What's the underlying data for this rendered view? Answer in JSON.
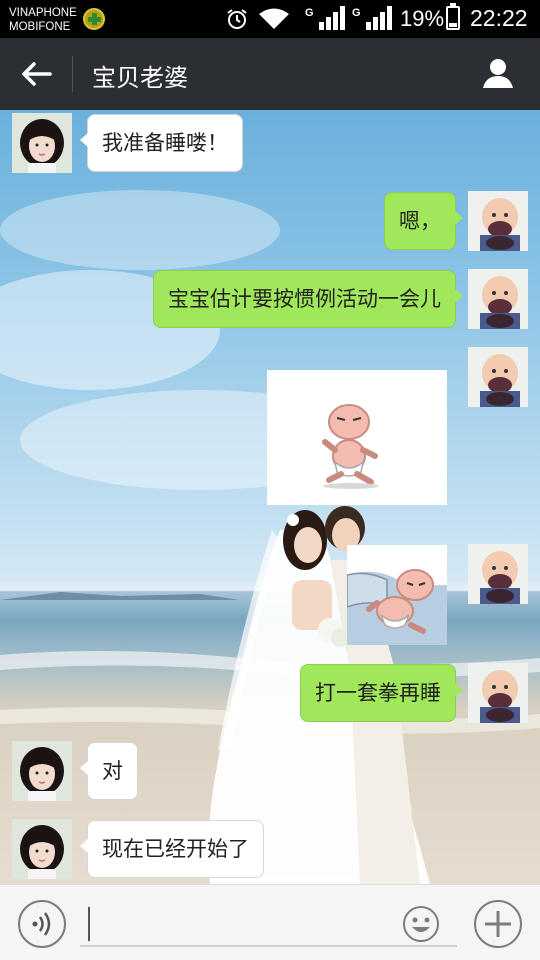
{
  "status_bar": {
    "carrier_1": "VINAPHONE",
    "carrier_2": "MOBIFONE",
    "network_1": "G",
    "network_2": "G",
    "battery": "19%",
    "time": "22:22"
  },
  "header": {
    "title": "宝贝老婆",
    "back_icon": "back-arrow-icon",
    "contact_icon": "person-icon"
  },
  "messages": [
    {
      "side": "left",
      "type": "text",
      "text": "我准备睡喽！"
    },
    {
      "side": "right",
      "type": "text",
      "text": "嗯，"
    },
    {
      "side": "right",
      "type": "text",
      "text": "宝宝估计要按惯例活动一会儿"
    },
    {
      "side": "right",
      "type": "sticker",
      "sticker": "baby-stretching-sticker"
    },
    {
      "side": "right",
      "type": "sticker",
      "sticker": "baby-sleeping-sticker"
    },
    {
      "side": "right",
      "type": "text",
      "text": "打一套拳再睡"
    },
    {
      "side": "left",
      "type": "text",
      "text": "对"
    },
    {
      "side": "left",
      "type": "text",
      "text": "现在已经开始了"
    }
  ],
  "colors": {
    "header_bg": "#2b2e33",
    "sent_bubble": "#a0e759",
    "received_bubble": "#ffffff"
  },
  "input_bar": {
    "voice_icon": "voice-icon",
    "emoji_icon": "emoji-icon",
    "plus_icon": "plus-icon"
  }
}
